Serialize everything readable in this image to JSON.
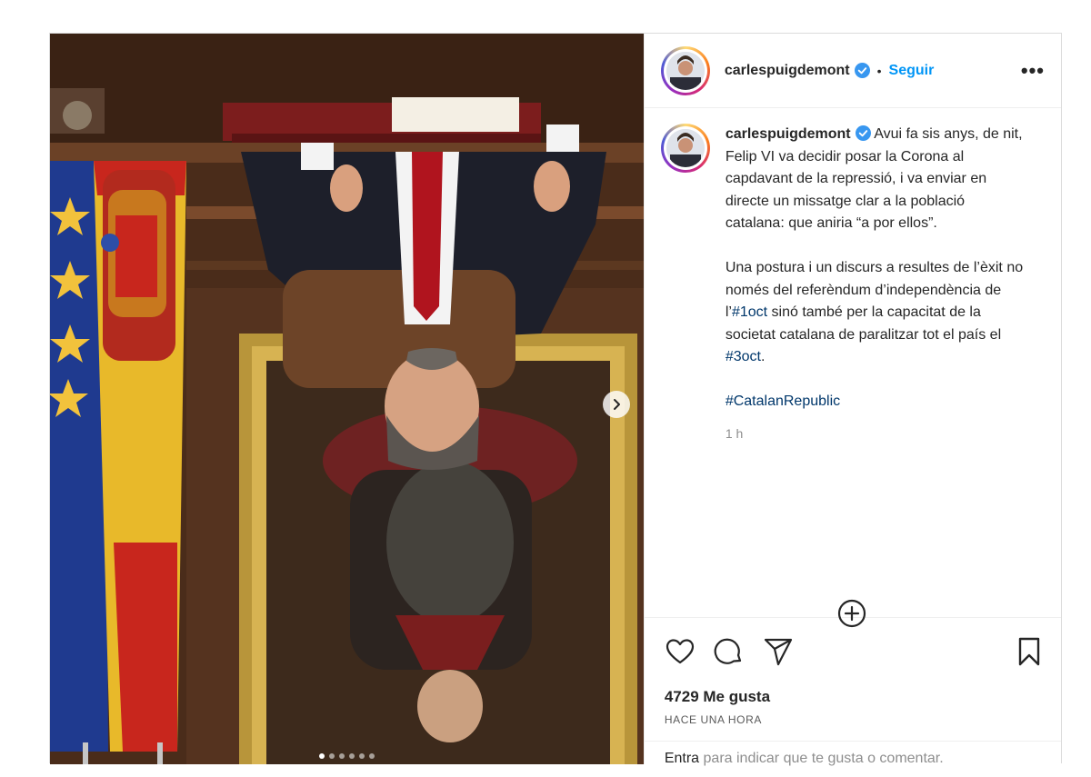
{
  "post": {
    "username": "carlespuigdemont",
    "follow_label": "Seguir",
    "separator": "•",
    "more_label": "•••"
  },
  "caption": {
    "username": "carlespuigdemont",
    "paragraph1": "Avui fa sis anys, de nit, Felip VI va decidir posar la Corona al capdavant de la repressió, i va enviar en directe un missatge clar a la població catalana: que aniria “a por ellos”.",
    "paragraph2_start": "Una postura i un discurs a resultes de l’èxit no només del referèndum d’independència de l’",
    "tag_1oct": "#1oct",
    "paragraph2_mid": " sinó també per la capacitat de la societat catalana de paralitzar tot el país el ",
    "tag_3oct": "#3oct",
    "paragraph2_end": ".",
    "tag_catalan": "#CatalanRepublic",
    "time": "1 h"
  },
  "engagement": {
    "likes": "4729 Me gusta",
    "posted": "HACE UNA HORA"
  },
  "comment": {
    "enter_label": "Entra",
    "rest": " para indicar que te gusta o comentar."
  },
  "media": {
    "slide_count": 6,
    "active_slide": 1
  },
  "icons": {
    "verified": "verified-badge-icon",
    "like": "heart-icon",
    "comment": "comment-bubble-icon",
    "share": "paper-plane-icon",
    "save": "bookmark-icon",
    "next": "chevron-right-icon",
    "load_more": "plus-circle-icon"
  },
  "colors": {
    "link_blue": "#0095f6",
    "hashtag": "#00376b",
    "verified_blue": "#3897f0"
  }
}
